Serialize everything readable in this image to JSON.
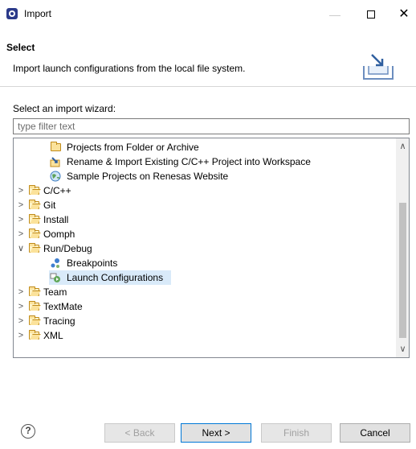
{
  "window": {
    "title": "Import",
    "minimize_glyph": "—",
    "close_glyph": "✕"
  },
  "banner": {
    "title": "Select",
    "description": "Import launch configurations from the local file system.",
    "icon": "import-icon"
  },
  "wizard": {
    "label": "Select an import wizard:",
    "filter_placeholder": "type filter text",
    "filter_value": ""
  },
  "tree": {
    "items": [
      {
        "label": "Projects from Folder or Archive",
        "level": 2,
        "icon": "folder-icon"
      },
      {
        "label": "Rename & Import Existing C/C++ Project into Workspace",
        "level": 2,
        "icon": "import-project-icon"
      },
      {
        "label": "Sample Projects on Renesas Website",
        "level": 2,
        "icon": "globe-icon"
      },
      {
        "label": "C/C++",
        "level": 1,
        "icon": "folder-icon",
        "expanded": false
      },
      {
        "label": "Git",
        "level": 1,
        "icon": "folder-icon",
        "expanded": false
      },
      {
        "label": "Install",
        "level": 1,
        "icon": "folder-icon",
        "expanded": false
      },
      {
        "label": "Oomph",
        "level": 1,
        "icon": "folder-icon",
        "expanded": false
      },
      {
        "label": "Run/Debug",
        "level": 1,
        "icon": "folder-icon",
        "expanded": true
      },
      {
        "label": "Breakpoints",
        "level": 2,
        "icon": "breakpoints-icon"
      },
      {
        "label": "Launch Configurations",
        "level": 2,
        "icon": "launch-config-icon",
        "selected": true
      },
      {
        "label": "Team",
        "level": 1,
        "icon": "folder-icon",
        "expanded": false
      },
      {
        "label": "TextMate",
        "level": 1,
        "icon": "folder-icon",
        "expanded": false
      },
      {
        "label": "Tracing",
        "level": 1,
        "icon": "folder-icon",
        "expanded": false
      },
      {
        "label": "XML",
        "level": 1,
        "icon": "folder-icon",
        "expanded": false
      }
    ]
  },
  "buttons": {
    "help": "?",
    "back": "< Back",
    "next": "Next >",
    "finish": "Finish",
    "cancel": "Cancel"
  },
  "colors": {
    "selection": "#d9eaf9",
    "default_button_border": "#0078d7"
  }
}
